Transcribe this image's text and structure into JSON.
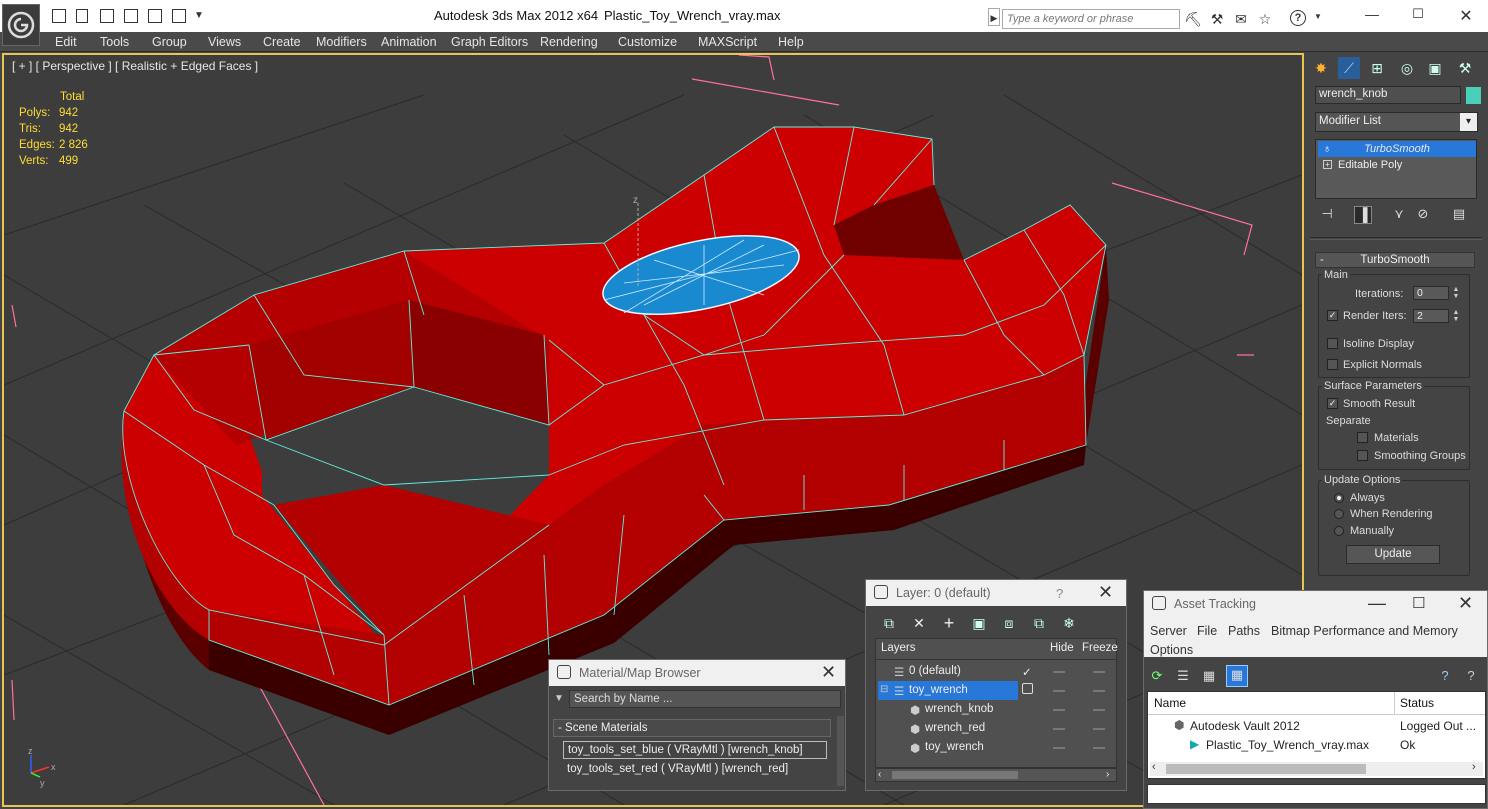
{
  "window": {
    "app_title": "Autodesk 3ds Max  2012 x64",
    "file_title": "Plastic_Toy_Wrench_vray.max",
    "search_placeholder": "Type a keyword or phrase",
    "help_label": "?"
  },
  "menu": [
    "Edit",
    "Tools",
    "Group",
    "Views",
    "Create",
    "Modifiers",
    "Animation",
    "Graph Editors",
    "Rendering",
    "Customize",
    "MAXScript",
    "Help"
  ],
  "viewport": {
    "label": "[ + ] [ Perspective ] [ Realistic + Edged Faces ]",
    "stats_header": "Total",
    "stats": [
      {
        "label": "Polys:",
        "value": "942"
      },
      {
        "label": "Tris:",
        "value": "942"
      },
      {
        "label": "Edges:",
        "value": "2 826"
      },
      {
        "label": "Verts:",
        "value": "499"
      }
    ],
    "gizmo_axis_label": "z",
    "axis_labels": {
      "x": "x",
      "y": "y",
      "z": "z"
    }
  },
  "command_panel": {
    "object_name": "wrench_knob",
    "object_color": "#4ad0b8",
    "modifier_list_label": "Modifier List",
    "stack": [
      "TurboSmooth",
      "Editable Poly"
    ],
    "rollout_title": "TurboSmooth",
    "main_group": "Main",
    "iterations_label": "Iterations:",
    "iterations_value": "0",
    "render_iters_label": "Render Iters:",
    "render_iters_value": "2",
    "isoline_label": "Isoline Display",
    "explicit_normals_label": "Explicit Normals",
    "surface_group": "Surface Parameters",
    "smooth_result_label": "Smooth Result",
    "separate_label": "Separate",
    "materials_label": "Materials",
    "smoothing_groups_label": "Smoothing Groups",
    "update_group": "Update Options",
    "radio_always": "Always",
    "radio_when_rendering": "When Rendering",
    "radio_manually": "Manually",
    "update_button": "Update"
  },
  "material_browser": {
    "title": "Material/Map Browser",
    "search_placeholder": "Search by Name ...",
    "section": "- Scene Materials",
    "rows": [
      "toy_tools_set_blue  ( VRayMtl )  [wrench_knob]",
      "toy_tools_set_red  ( VRayMtl )  [wrench_red]"
    ]
  },
  "layer_dialog": {
    "title": "Layer: 0 (default)",
    "help": "?",
    "columns": [
      "Layers",
      "Hide",
      "Freeze"
    ],
    "rows": [
      {
        "name": "0 (default)"
      },
      {
        "name": "toy_wrench"
      },
      {
        "name": "wrench_knob"
      },
      {
        "name": "wrench_red"
      },
      {
        "name": "toy_wrench"
      }
    ]
  },
  "asset_tracking": {
    "title": "Asset Tracking",
    "menu": [
      "Server",
      "File",
      "Paths",
      "Bitmap Performance and Memory",
      "Options"
    ],
    "columns": [
      "Name",
      "Status"
    ],
    "rows": [
      {
        "name": "Autodesk Vault 2012",
        "status": "Logged Out ..."
      },
      {
        "name": "Plastic_Toy_Wrench_vray.max",
        "status": "Ok"
      }
    ]
  },
  "colors": {
    "wrench_red": "#cc0000",
    "knob_blue": "#1a8ad0",
    "wire": "#5ef0e0",
    "viewport_border": "#e8c452",
    "selection": "#2778d8"
  }
}
